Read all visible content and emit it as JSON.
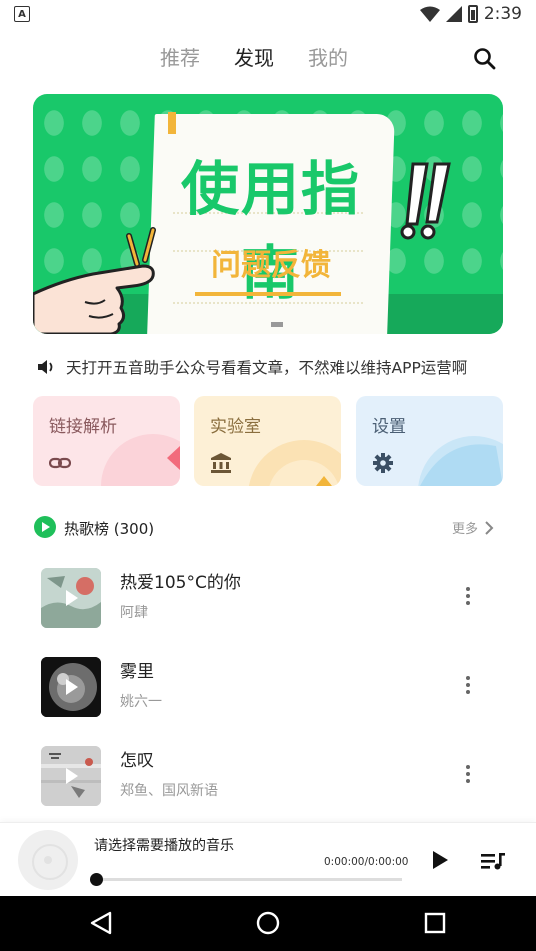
{
  "status_bar": {
    "app_badge": "A",
    "time": "2:39"
  },
  "nav": {
    "tabs": [
      {
        "label": "推荐",
        "active": false
      },
      {
        "label": "发现",
        "active": true
      },
      {
        "label": "我的",
        "active": false
      }
    ]
  },
  "banner": {
    "title": "使用指南",
    "subtitle": "问题反馈"
  },
  "notice": {
    "text": "天打开五音助手公众号看看文章，不然难以维持APP运营啊"
  },
  "cards": [
    {
      "label": "链接解析",
      "icon": "link-icon"
    },
    {
      "label": "实验室",
      "icon": "bank-icon"
    },
    {
      "label": "设置",
      "icon": "gear-icon"
    }
  ],
  "section": {
    "title": "热歌榜 (300)",
    "more_label": "更多"
  },
  "songs": [
    {
      "title": "热爱105°C的你",
      "artist": "阿肆"
    },
    {
      "title": "雾里",
      "artist": "姚六一"
    },
    {
      "title": "怎叹",
      "artist": "郑鱼、国风新语"
    }
  ],
  "player": {
    "hint": "请选择需要播放的音乐",
    "time": "0:00:00/0:00:00",
    "progress": 0
  },
  "colors": {
    "accent_green": "#19c86a",
    "banner_yellow": "#f2b53a"
  }
}
